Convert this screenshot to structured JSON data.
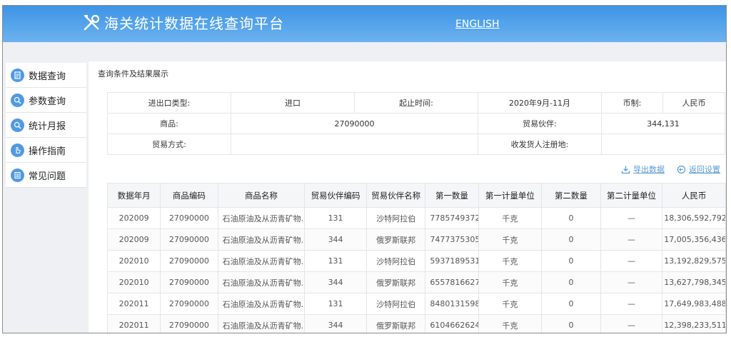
{
  "header": {
    "title": "海关统计数据在线查询平台",
    "english_link": "ENGLISH"
  },
  "sidebar": {
    "items": [
      {
        "label": "数据查询",
        "icon": "document-icon"
      },
      {
        "label": "参数查询",
        "icon": "search-icon"
      },
      {
        "label": "统计月报",
        "icon": "search-icon"
      },
      {
        "label": "操作指南",
        "icon": "hand-pointer-icon"
      },
      {
        "label": "常见问题",
        "icon": "list-icon"
      }
    ]
  },
  "panel": {
    "title": "查询条件及结果展示"
  },
  "conditions": {
    "trade_type_label": "进出口类型:",
    "trade_type_value": "进口",
    "period_label": "起止时间:",
    "period_value": "2020年9月-11月",
    "currency_label": "币制:",
    "currency_value": "人民币",
    "commodity_label": "商品:",
    "commodity_value": "27090000",
    "partner_label": "贸易伙伴:",
    "partner_value": "344,131",
    "mode_label": "贸易方式:",
    "mode_value": "",
    "consignee_label": "收发货人注册地:",
    "consignee_value": ""
  },
  "actions": {
    "export_label": "导出数据",
    "reset_label": "返回设置"
  },
  "table": {
    "columns": [
      "数据年月",
      "商品编码",
      "商品名称",
      "贸易伙伴编码",
      "贸易伙伴名称",
      "第一数量",
      "第一计量单位",
      "第二数量",
      "第二计量单位",
      "人民币"
    ],
    "rows": [
      [
        "202009",
        "27090000",
        "石油原油及从沥青矿物...",
        "131",
        "沙特阿拉伯",
        "7785749372",
        "千克",
        "0",
        "—",
        "18,306,592,792"
      ],
      [
        "202009",
        "27090000",
        "石油原油及从沥青矿物...",
        "344",
        "俄罗斯联邦",
        "7477375305",
        "千克",
        "0",
        "—",
        "17,005,356,436"
      ],
      [
        "202010",
        "27090000",
        "石油原油及从沥青矿物...",
        "131",
        "沙特阿拉伯",
        "5937189531",
        "千克",
        "0",
        "—",
        "13,192,829,575"
      ],
      [
        "202010",
        "27090000",
        "石油原油及从沥青矿物...",
        "344",
        "俄罗斯联邦",
        "6557816627",
        "千克",
        "0",
        "—",
        "13,627,798,345"
      ],
      [
        "202011",
        "27090000",
        "石油原油及从沥青矿物...",
        "131",
        "沙特阿拉伯",
        "8480131598",
        "千克",
        "0",
        "—",
        "17,649,983,488"
      ],
      [
        "202011",
        "27090000",
        "石油原油及从沥青矿物...",
        "344",
        "俄罗斯联邦",
        "6104662624",
        "千克",
        "0",
        "—",
        "12,398,233,511"
      ]
    ]
  },
  "colors": {
    "header_top": "#3d94e6",
    "header_bottom": "#6cb2ef",
    "accent": "#4f9ae3",
    "link": "#5b9bd5"
  }
}
